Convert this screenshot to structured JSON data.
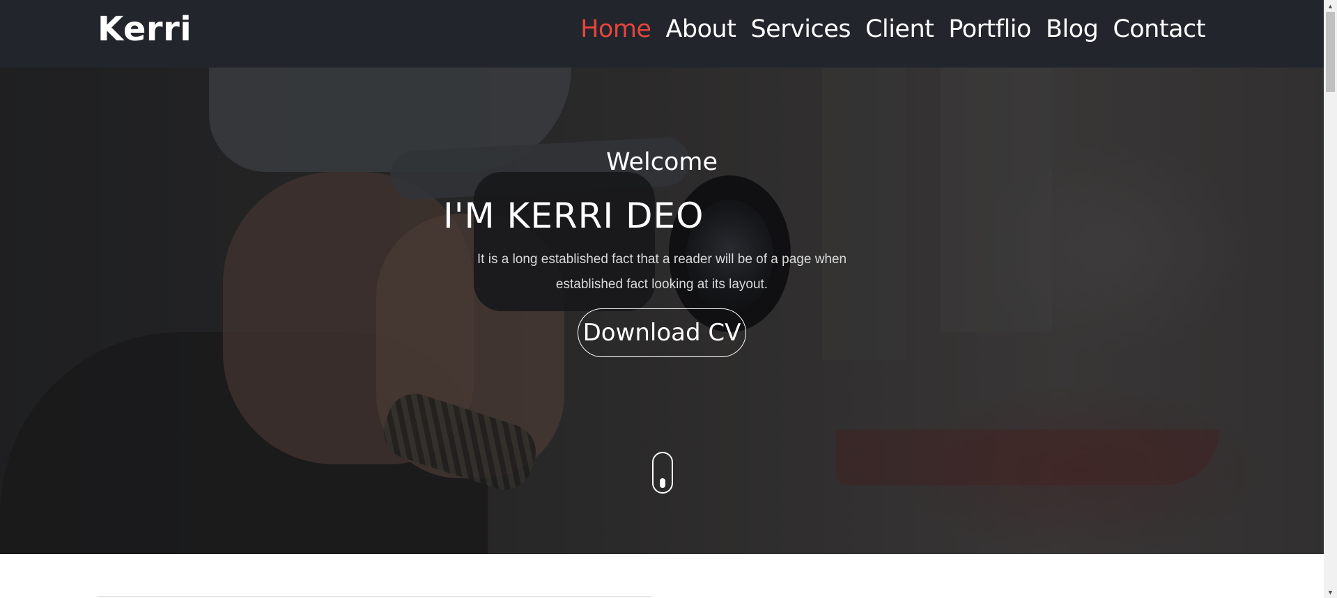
{
  "navbar": {
    "brand": "Kerri",
    "items": [
      {
        "label": "Home",
        "active": true
      },
      {
        "label": "About",
        "active": false
      },
      {
        "label": "Services",
        "active": false
      },
      {
        "label": "Client",
        "active": false
      },
      {
        "label": "Portflio",
        "active": false
      },
      {
        "label": "Blog",
        "active": false
      },
      {
        "label": "Contact",
        "active": false
      }
    ]
  },
  "hero": {
    "welcome": "Welcome",
    "headline": "I'M KERRI DEO",
    "subtext": "It is a long established fact that a reader will be of a page when established fact looking at its layout.",
    "cta_label": "Download CV",
    "scroll_icon": "mouse-scroll-icon"
  },
  "colors": {
    "navbar_bg": "#22252c",
    "accent": "#e5453d",
    "text_light": "#ffffff"
  },
  "scrollbar": {
    "up_icon": "▲",
    "down_icon": "▼"
  }
}
